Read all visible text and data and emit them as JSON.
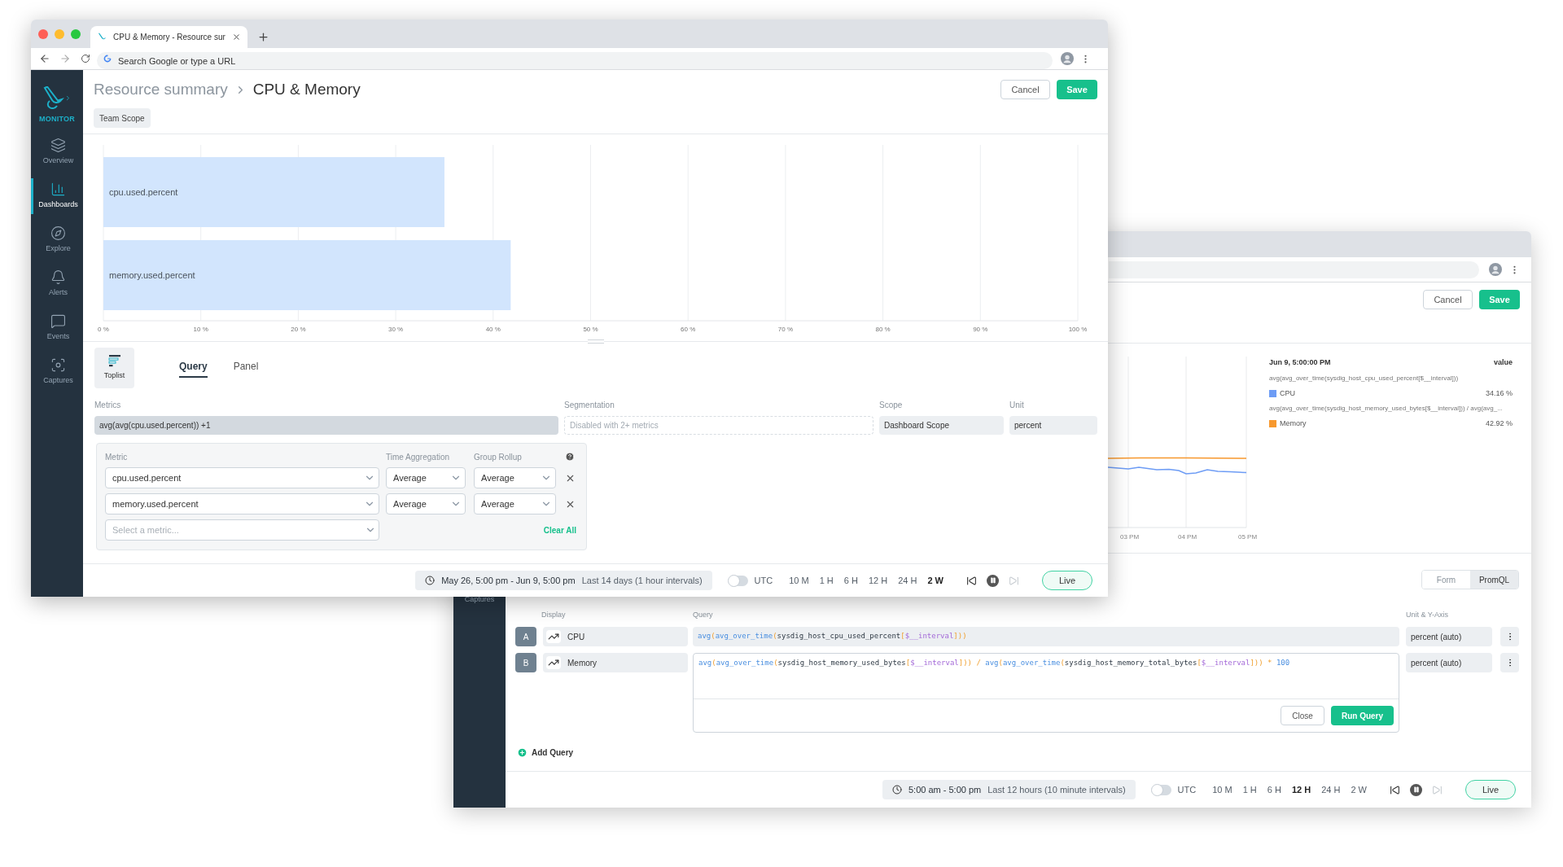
{
  "front_window": {
    "browser": {
      "tab_title": "CPU & Memory - Resource sur",
      "address_placeholder": "Search Google or type a URL"
    },
    "sidebar": {
      "brand": "MONITOR",
      "items": [
        {
          "label": "Overview",
          "selected": false
        },
        {
          "label": "Dashboards",
          "selected": true
        },
        {
          "label": "Explore",
          "selected": false
        },
        {
          "label": "Alerts",
          "selected": false
        },
        {
          "label": "Events",
          "selected": false
        },
        {
          "label": "Captures",
          "selected": false
        }
      ]
    },
    "header": {
      "breadcrumb_parent": "Resource summary",
      "breadcrumb_current": "CPU & Memory",
      "cancel": "Cancel",
      "save": "Save",
      "scope_chip": "Team Scope"
    },
    "chart": {
      "chart_data": {
        "type": "bar",
        "orientation": "horizontal",
        "categories": [
          "cpu.used.percent",
          "memory.used.percent"
        ],
        "values": [
          35.0,
          41.8
        ],
        "xlim": [
          0,
          100
        ],
        "grid": true,
        "xticks": [
          {
            "value": 0,
            "label": "0 %"
          },
          {
            "value": 10,
            "label": "10 %"
          },
          {
            "value": 20,
            "label": "20 %"
          },
          {
            "value": 30,
            "label": "30 %"
          },
          {
            "value": 40,
            "label": "40 %"
          },
          {
            "value": 50,
            "label": "50 %"
          },
          {
            "value": 60,
            "label": "60 %"
          },
          {
            "value": 70,
            "label": "70 %"
          },
          {
            "value": 80,
            "label": "80 %"
          },
          {
            "value": 90,
            "label": "90 %"
          },
          {
            "value": 100,
            "label": "100 %"
          }
        ]
      }
    },
    "panel_type": "Toplist",
    "tabs": [
      {
        "label": "Query",
        "selected": true
      },
      {
        "label": "Panel",
        "selected": false
      }
    ],
    "fields": {
      "metrics": {
        "label": "Metrics",
        "value": "avg(avg(cpu.used.percent)) +1"
      },
      "segmentation": {
        "label": "Segmentation",
        "placeholder": "Disabled with 2+ metrics"
      },
      "scope": {
        "label": "Scope",
        "value": "Dashboard Scope"
      },
      "unit": {
        "label": "Unit",
        "value": "percent"
      }
    },
    "metric_editor": {
      "columns": [
        "Metric",
        "Time Aggregation",
        "Group Rollup"
      ],
      "rows": [
        {
          "metric": "cpu.used.percent",
          "time_aggregation": "Average",
          "group_rollup": "Average"
        },
        {
          "metric": "memory.used.percent",
          "time_aggregation": "Average",
          "group_rollup": "Average"
        }
      ],
      "new_metric_placeholder": "Select a metric...",
      "clear_all": "Clear All"
    },
    "time_bar": {
      "range": "May 26, 5:00 pm - Jun 9, 5:00 pm",
      "description": "Last 14 days (1 hour intervals)",
      "utc": {
        "label": "UTC",
        "on": false
      },
      "presets": [
        {
          "label": "10 M",
          "selected": false
        },
        {
          "label": "1 H",
          "selected": false
        },
        {
          "label": "6 H",
          "selected": false
        },
        {
          "label": "12 H",
          "selected": false
        },
        {
          "label": "24 H",
          "selected": false
        },
        {
          "label": "2 W",
          "selected": true
        }
      ],
      "live": "Live"
    }
  },
  "back_window": {
    "header": {
      "cancel": "Cancel",
      "save": "Save"
    },
    "chart": {
      "x_tick_labels": [
        "03 PM",
        "04 PM",
        "05 PM"
      ]
    },
    "legend": {
      "timestamp": "Jun 9, 5:00:00 PM",
      "value_heading": "value",
      "entries": [
        {
          "query": "avg(avg_over_time(sysdig_host_cpu_used_percent[$__interval]))",
          "name": "CPU",
          "color": "#6d9cf5",
          "value": "34.16 %"
        },
        {
          "query": "avg(avg_over_time(sysdig_host_memory_used_bytes[$__interval])) / avg(avg_...",
          "name": "Memory",
          "color": "#f7982e",
          "value": "42.92 %"
        }
      ]
    },
    "sidebar": {
      "items": [
        {
          "label": "Captures"
        }
      ]
    },
    "mode_toggle": [
      {
        "label": "Form",
        "selected": false
      },
      {
        "label": "PromQL",
        "selected": true
      }
    ],
    "queries": {
      "columns": [
        "Display",
        "Query",
        "Unit & Y-Axis"
      ],
      "rows": [
        {
          "letter": "A",
          "display": "CPU",
          "query": "avg(avg_over_time(sysdig_host_cpu_used_percent[$__interval]))",
          "unit": "percent (auto)",
          "editing": false
        },
        {
          "letter": "B",
          "display": "Memory",
          "query": "avg(avg_over_time(sysdig_host_memory_used_bytes[$__interval])) / avg(avg_over_time(sysdig_host_memory_total_bytes[$__interval])) * 100",
          "unit": "percent (auto)",
          "editing": true
        }
      ],
      "close": "Close",
      "run": "Run Query",
      "add": "Add Query"
    },
    "time_bar": {
      "range": "5:00 am - 5:00 pm",
      "description": "Last 12 hours (10 minute intervals)",
      "utc": {
        "label": "UTC",
        "on": false
      },
      "presets": [
        {
          "label": "10 M",
          "selected": false
        },
        {
          "label": "1 H",
          "selected": false
        },
        {
          "label": "6 H",
          "selected": false
        },
        {
          "label": "12 H",
          "selected": true
        },
        {
          "label": "24 H",
          "selected": false
        },
        {
          "label": "2 W",
          "selected": false
        }
      ],
      "live": "Live"
    }
  }
}
